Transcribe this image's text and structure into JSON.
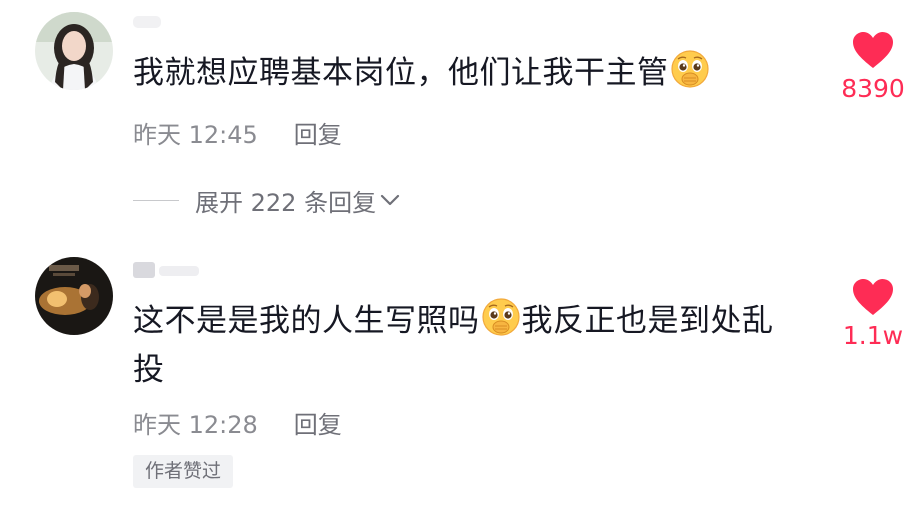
{
  "comments": [
    {
      "text_main": "我就想应聘基本岗位，他们让我干主管",
      "emoji": "pleading-covering-mouth-emoji",
      "text_after": "",
      "time": "昨天 12:45",
      "reply": "回复",
      "likes": "8390"
    },
    {
      "text_main": "这不是是我的人生写照吗",
      "emoji": "pleading-covering-mouth-emoji",
      "text_after": "我反正也是到处乱投",
      "time": "昨天 12:28",
      "reply": "回复",
      "likes": "1.1w",
      "badge": "作者赞过"
    }
  ],
  "expand_label": "展开 222 条回复",
  "colors": {
    "like": "#fe2c55",
    "text": "#161823",
    "meta": "#8a8b91"
  }
}
